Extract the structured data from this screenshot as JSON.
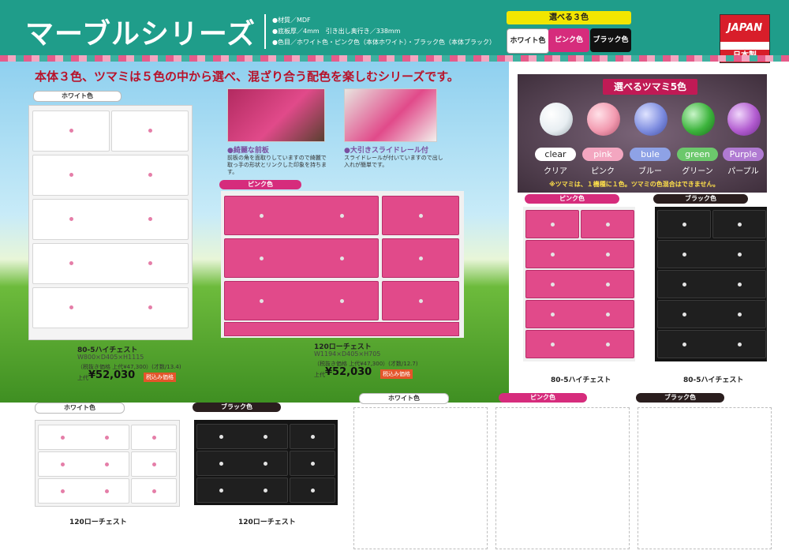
{
  "header": {
    "title": "マーブルシリーズ",
    "specs": [
      "●材質／MDF",
      "●底板厚／4mm　引き出し奥行き／338mm",
      "●色目／ホワイト色・ピンク色（本体ホワイト）・ブラック色（本体ブラック）"
    ],
    "color_choice_title": "選べる３色",
    "color_choices": [
      {
        "label": "ホワイト色",
        "bg": "#ffffff",
        "fg": "#222222"
      },
      {
        "label": "ピンク色",
        "bg": "#d62c7c",
        "fg": "#ffffff"
      },
      {
        "label": "ブラック色",
        "bg": "#111111",
        "fg": "#ffffff"
      }
    ],
    "badge_top": "JAPAN",
    "badge_bottom": "日本製"
  },
  "hero": {
    "tagline": "本体３色、ツマミは５色の中から選べ、混ざり合う配色を楽しむシリーズです。",
    "white_tag": "ホワイト色",
    "pink_tag": "ピンク色",
    "features": [
      {
        "head": "●綺麗な前板",
        "body": "前板の角を面取りしていますので綺麗で取っ手の形状とリンクした印象を持ちます。"
      },
      {
        "head": "●大引きスライドレール付",
        "body": "スライドレールが付いていますので出し入れが簡単です。"
      }
    ],
    "product_hi": {
      "name": "80-5ハイチェスト",
      "dims": "W800×D405×H1115",
      "note": "（税抜き価格 上代¥47,300）(才数/13.4)",
      "price_prefix": "上代",
      "price": "¥52,030",
      "tax": "税込み価格"
    },
    "product_low": {
      "name": "120ローチェスト",
      "dims": "W1194×D405×H705",
      "note": "（税抜き価格 上代¥47,300）(才数/12.7)",
      "price_prefix": "上代",
      "price": "¥52,030",
      "tax": "税込み価格"
    }
  },
  "knobs": {
    "title": "選べるツマミ5色",
    "items": [
      {
        "en": "clear",
        "jp": "クリア",
        "color": "#e8eef2",
        "label_bg": "#ffffff",
        "label_fg": "#222222"
      },
      {
        "en": "pink",
        "jp": "ピンク",
        "color": "#f29ab0",
        "label_bg": "#f3a6c0",
        "label_fg": "#ffffff"
      },
      {
        "en": "bule",
        "jp": "ブルー",
        "color": "#7e8de0",
        "label_bg": "#8ea2e6",
        "label_fg": "#ffffff"
      },
      {
        "en": "green",
        "jp": "グリーン",
        "color": "#3cb43c",
        "label_bg": "#6cc86c",
        "label_fg": "#ffffff"
      },
      {
        "en": "Purple",
        "jp": "パープル",
        "color": "#b25cd0",
        "label_bg": "#b07ad2",
        "label_fg": "#ffffff"
      }
    ],
    "note": "※ツマミは、１機種に１色。ツマミの色混合はできません。"
  },
  "right_products": {
    "pink_tag": "ピンク色",
    "black_tag": "ブラック色",
    "pink_name": "80-5ハイチェスト",
    "black_name": "80-5ハイチェスト"
  },
  "bottom": {
    "white_tag": "ホワイト色",
    "black_tag": "ブラック色",
    "white_name": "120ローチェスト",
    "black_name": "120ローチェスト",
    "empty_tags": [
      "ホワイト色",
      "ピンク色",
      "ブラック色"
    ]
  }
}
